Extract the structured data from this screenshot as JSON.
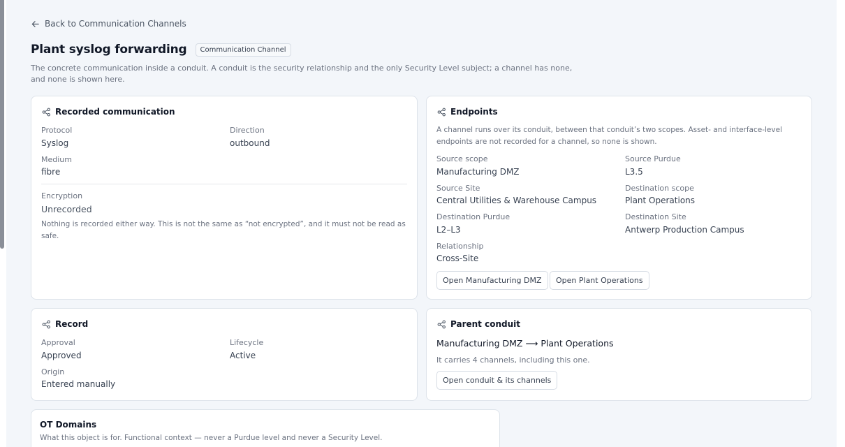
{
  "nav": {
    "back_label": "Back to Communication Channels"
  },
  "header": {
    "title": "Plant syslog forwarding",
    "badge": "Communication Channel",
    "subtitle": "The concrete communication inside a conduit. A conduit is the security relationship and the only Security Level subject; a channel has none, and none is shown here."
  },
  "recorded": {
    "title": "Recorded communication",
    "protocol_label": "Protocol",
    "protocol_value": "Syslog",
    "direction_label": "Direction",
    "direction_value": "outbound",
    "medium_label": "Medium",
    "medium_value": "fibre",
    "encryption_label": "Encryption",
    "encryption_value": "Unrecorded",
    "encryption_note": "Nothing is recorded either way. This is not the same as “not encrypted”, and it must not be read as safe."
  },
  "endpoints": {
    "title": "Endpoints",
    "note": "A channel runs over its conduit, between that conduit’s two scopes. Asset- and interface-level endpoints are not recorded for a channel, so none is shown.",
    "source_scope_label": "Source scope",
    "source_scope_value": "Manufacturing DMZ",
    "source_purdue_label": "Source Purdue",
    "source_purdue_value": "L3.5",
    "source_site_label": "Source Site",
    "source_site_value": "Central Utilities & Warehouse Campus",
    "dest_scope_label": "Destination scope",
    "dest_scope_value": "Plant Operations",
    "dest_purdue_label": "Destination Purdue",
    "dest_purdue_value": "L2–L3",
    "dest_site_label": "Destination Site",
    "dest_site_value": "Antwerp Production Campus",
    "relationship_label": "Relationship",
    "relationship_value": "Cross-Site",
    "open_source_button": "Open Manufacturing DMZ",
    "open_dest_button": "Open Plant Operations"
  },
  "record": {
    "title": "Record",
    "approval_label": "Approval",
    "approval_value": "Approved",
    "lifecycle_label": "Lifecycle",
    "lifecycle_value": "Active",
    "origin_label": "Origin",
    "origin_value": "Entered manually"
  },
  "parent": {
    "title": "Parent conduit",
    "conduit_name": "Manufacturing DMZ ⟶ Plant Operations",
    "summary": "It carries 4 channels, including this one.",
    "open_button": "Open conduit & its channels"
  },
  "ot_domains": {
    "title": "OT Domains",
    "note": "What this object is for. Functional context — never a Purdue level and never a Security Level."
  },
  "icons": {
    "back": "arrow-left-icon",
    "section": "share-nodes-icon"
  },
  "colors": {
    "page_bg": "#f3f6fa",
    "card_bg": "#ffffff",
    "border": "#dde3ea",
    "muted_text": "#6b7280"
  }
}
